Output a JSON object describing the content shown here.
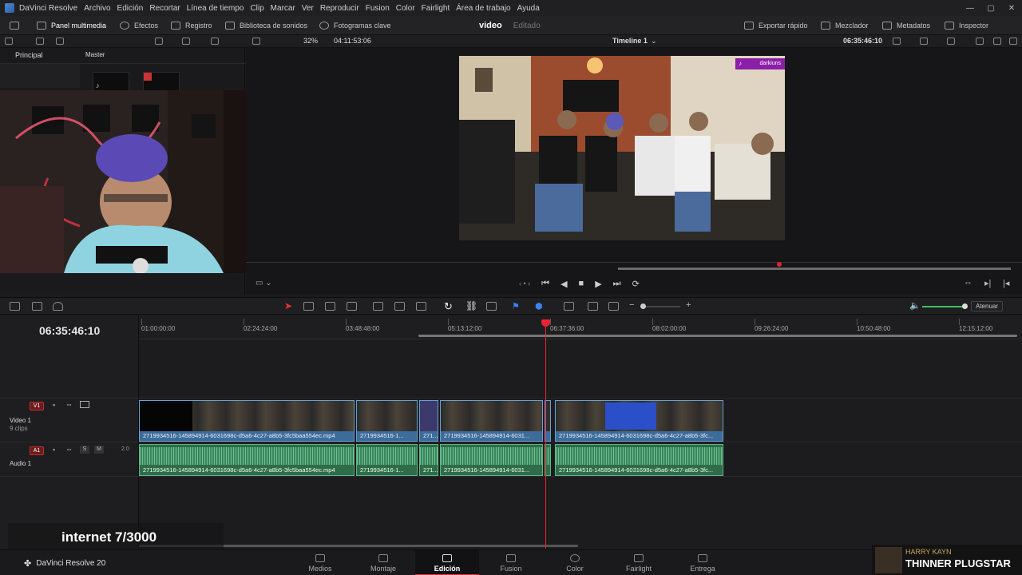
{
  "menubar": {
    "app_name": "DaVinci Resolve",
    "items": [
      "Archivo",
      "Edición",
      "Recortar",
      "Línea de tiempo",
      "Clip",
      "Marcar",
      "Ver",
      "Reproducir",
      "Fusion",
      "Color",
      "Fairlight",
      "Área de trabajo",
      "Ayuda"
    ]
  },
  "toolbar": {
    "media_pool": "Panel multimedia",
    "effects": "Efectos",
    "log": "Registro",
    "sound_library": "Biblioteca de sonidos",
    "keyframes": "Fotogramas clave",
    "project_name": "video",
    "project_status": "Editado",
    "quick_export": "Exportar rápido",
    "mixer": "Mezclador",
    "metadata": "Metadatos",
    "inspector": "Inspector"
  },
  "subbar": {
    "zoom": "32%",
    "source_timecode": "04:11:53:06",
    "timeline_name": "Timeline 1",
    "record_timecode": "06:35:46:10"
  },
  "media_pool": {
    "tab_main": "Principal",
    "bin_master": "Master"
  },
  "video_overlay": {
    "channel_tag": "darkiuns"
  },
  "timeline": {
    "current_timecode": "06:35:46:10",
    "ruler_ticks": [
      "01:00:00:00",
      "02:24:24:00",
      "03:48:48:00",
      "05:13:12:00",
      "06:37:36:00",
      "08:02:00:00",
      "09:26:24:00",
      "10:50:48:00",
      "12:15:12:00"
    ],
    "video_track": {
      "badge": "V1",
      "name": "Video 1",
      "count": "9 clips"
    },
    "audio_track": {
      "badge": "A1",
      "name": "Audio 1",
      "solo": "S",
      "mute": "M",
      "level": "2.0"
    },
    "clip_full": "2719934516-145894914-6031698c-d5a6-4c27-a8b5-3fc5baa554ec.mp4",
    "clip_short_1": "2719934516-1...",
    "clip_short_2": "271...",
    "clip_short_3": "2719934516-145894914-6031...",
    "clip_full_2": "2719934516-145894914-6031698c-d5a6-4c27-a8b5-3fc...",
    "audio_mode": "Atenuar"
  },
  "pages": [
    {
      "label": "Medios"
    },
    {
      "label": "Montaje"
    },
    {
      "label": "Edición"
    },
    {
      "label": "Fusion"
    },
    {
      "label": "Color"
    },
    {
      "label": "Fairlight"
    },
    {
      "label": "Entrega"
    }
  ],
  "footer": {
    "brand": "DaVinci Resolve 20"
  },
  "stream_overlay": {
    "internet_text": "internet  7/3000",
    "music_artist": "HARRY KAYN",
    "music_title": "THINNER PLUGSTAR"
  },
  "colors": {
    "accent_red": "#e22233",
    "video_clip": "#3c6c9a",
    "audio_clip": "#2f6c4a",
    "channel_tag": "#8b1fa8"
  }
}
